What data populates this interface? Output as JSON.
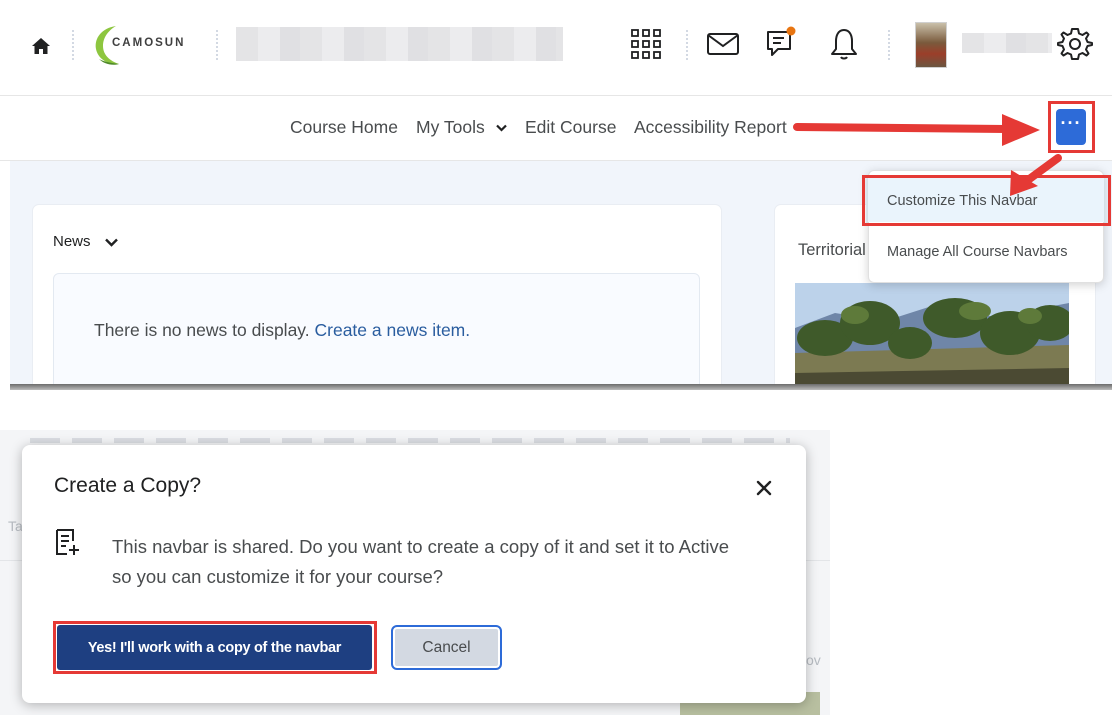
{
  "top": {
    "logo_text": "CAMOSUN",
    "navbar": {
      "items": [
        {
          "label": "Course Home"
        },
        {
          "label": "My Tools"
        },
        {
          "label": "Edit Course"
        },
        {
          "label": "Accessibility Report"
        }
      ],
      "more_label": "···"
    },
    "dropdown": {
      "items": [
        {
          "label": "Customize This Navbar"
        },
        {
          "label": "Manage All Course Navbars"
        }
      ]
    },
    "news": {
      "title": "News",
      "empty_text": "There is no news to display.",
      "link_text": "Create a news item."
    },
    "side_card": {
      "label": "Territorial"
    },
    "colors": {
      "accent": "#2d6bd8",
      "annotation": "#e53935",
      "link": "#2a5d9f"
    }
  },
  "dialog": {
    "title": "Create a Copy?",
    "message": "This navbar is shared. Do you want to create a copy of it and set it to Active so you can customize it for your course?",
    "primary_label": "Yes! I'll work with a copy of the navbar",
    "secondary_label": "Cancel",
    "colors": {
      "primary": "#1e3f81"
    }
  },
  "bottom_bg": {
    "fragments": [
      "Ta",
      "ov"
    ]
  }
}
